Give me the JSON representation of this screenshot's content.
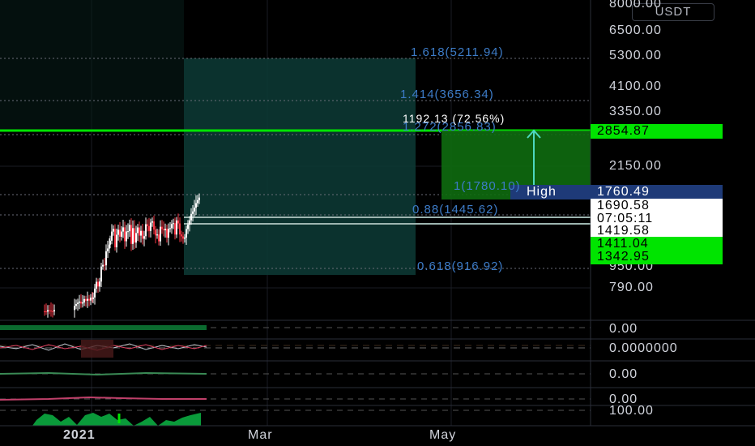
{
  "currency": "USDT",
  "price_axis": {
    "ticks": [
      "8000.00",
      "6500.00",
      "5300.00",
      "4100.00",
      "3350.00",
      "2150.00",
      "950.00",
      "790.00"
    ]
  },
  "price_tags": [
    {
      "name": "target-price-tag",
      "value": "2854.87",
      "bg": "#00e400",
      "fg": "#000000"
    },
    {
      "name": "high-price-tag",
      "value": "1760.49",
      "bg": "#1e3a78",
      "fg": "#ffffff"
    },
    {
      "name": "last-price-tag",
      "value": "1690.58",
      "bg": "#ffffff",
      "fg": "#000000"
    },
    {
      "name": "countdown-tag",
      "value": "07:05:11",
      "bg": "#ffffff",
      "fg": "#000000"
    },
    {
      "name": "level-price-tag",
      "value": "1419.58",
      "bg": "#ffffff",
      "fg": "#000000"
    },
    {
      "name": "support-price-tag-1",
      "value": "1411.04",
      "bg": "#00e400",
      "fg": "#000000"
    },
    {
      "name": "support-price-tag-2",
      "value": "1342.95",
      "bg": "#00e400",
      "fg": "#000000"
    }
  ],
  "high_label": "High",
  "fib_levels": [
    {
      "label": "1.618(5211.94)"
    },
    {
      "label": "1.414(3656.34)"
    },
    {
      "label": "1.272(2856.83)"
    },
    {
      "label": "1(1780.10)"
    },
    {
      "label": "0.88(1445.62)"
    },
    {
      "label": "0.618(916.92)"
    }
  ],
  "measure_label": "1192.13 (72.56%)",
  "indicator_axis": [
    "0.00",
    "0.0000000",
    "0.00",
    "0.00",
    "100.00"
  ],
  "time_axis": [
    "2021",
    "Mar",
    "May"
  ],
  "colors": {
    "up": "#ffffff",
    "down": "#f23645",
    "accent_green": "#00e400",
    "fib_blue": "#3d7cc8",
    "teal_zone": "#0d3b36"
  }
}
